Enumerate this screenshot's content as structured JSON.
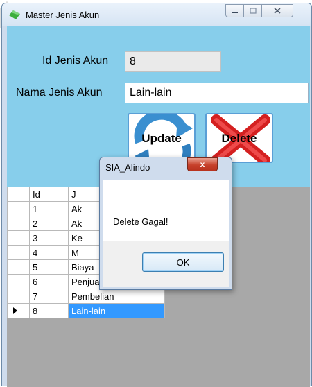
{
  "window": {
    "title": "Master Jenis Akun",
    "controls": {
      "minimize_icon": "minimize-icon",
      "maximize_icon": "maximize-icon",
      "close_icon": "close-icon"
    }
  },
  "form": {
    "id_label": "Id Jenis Akun",
    "id_value": "8",
    "name_label": "Nama Jenis Akun",
    "name_value": "Lain-lain",
    "update_label": "Update",
    "delete_label": "Delete"
  },
  "grid": {
    "columns": [
      "Id",
      "J"
    ],
    "rows": [
      {
        "id": "1",
        "name": "Ak"
      },
      {
        "id": "2",
        "name": "Ak"
      },
      {
        "id": "3",
        "name": "Ke"
      },
      {
        "id": "4",
        "name": "M"
      },
      {
        "id": "5",
        "name": "Biaya"
      },
      {
        "id": "6",
        "name": "Penjualan"
      },
      {
        "id": "7",
        "name": "Pembelian"
      },
      {
        "id": "8",
        "name": "Lain-lain"
      }
    ],
    "selected_row": 8
  },
  "dialog": {
    "title": "SIA_Alindo",
    "message": "Delete Gagal!",
    "ok_label": "OK",
    "close_glyph": "x"
  },
  "colors": {
    "panel": "#87ceeb",
    "selection": "#3399ff",
    "delete_x": "#d42020",
    "dialog_close": "#c7412b"
  }
}
